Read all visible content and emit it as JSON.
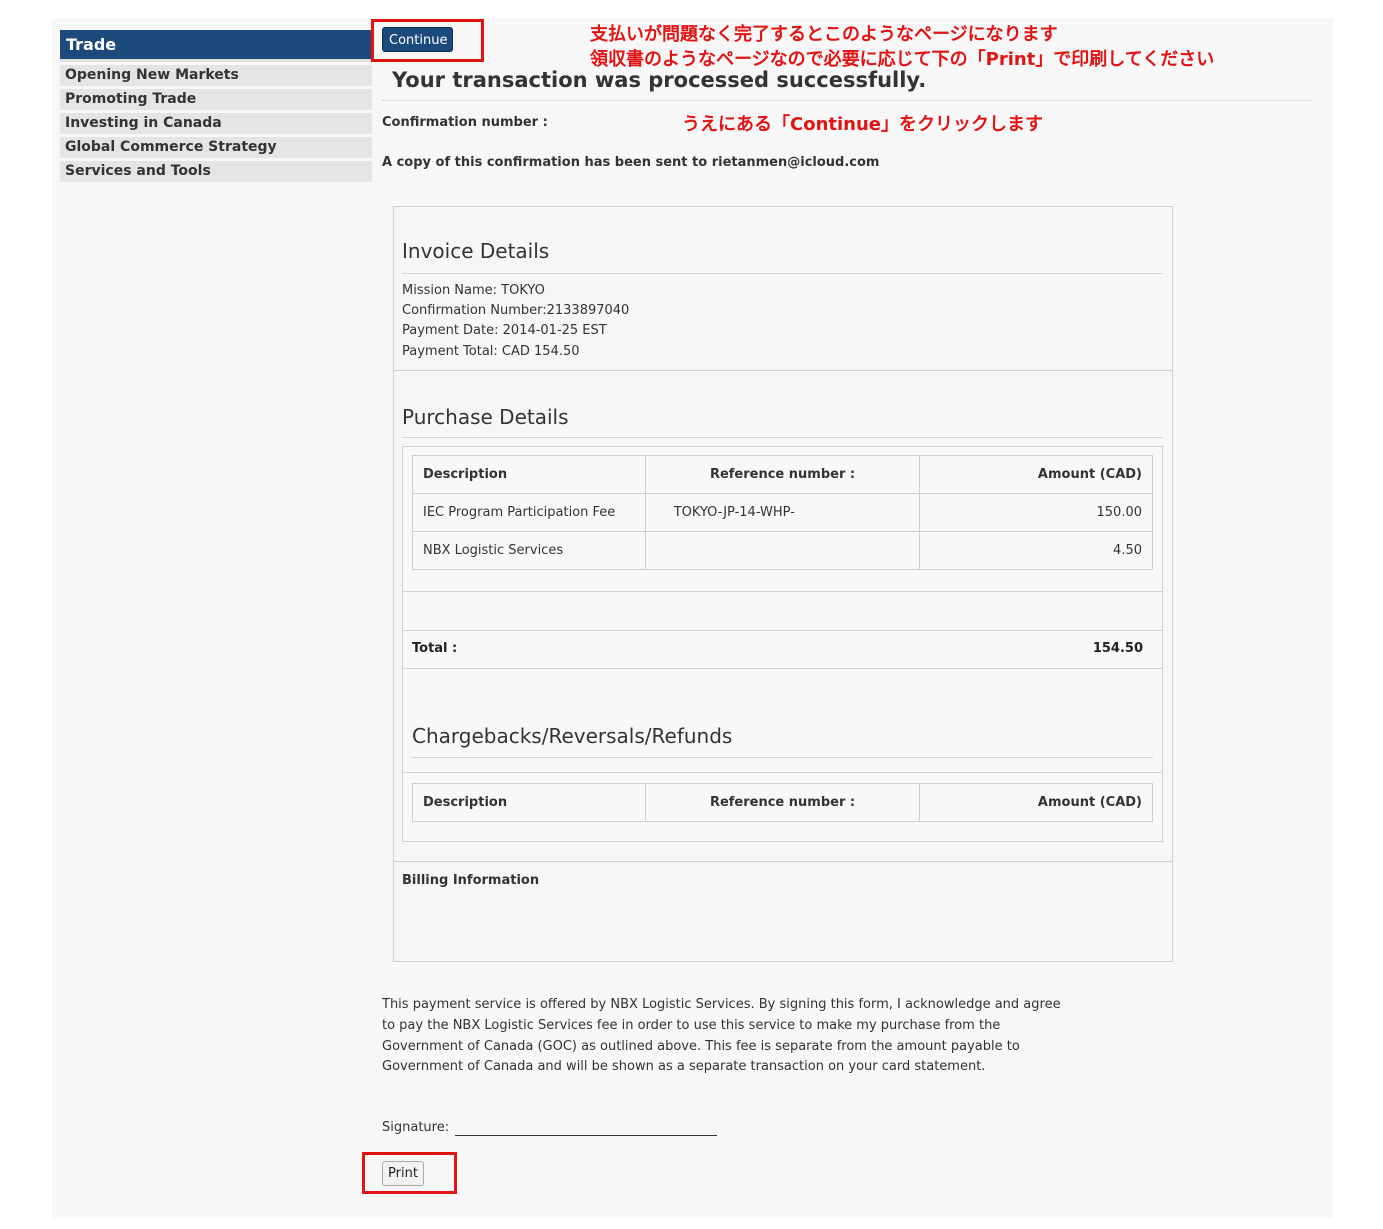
{
  "sidebar": {
    "heading": "Trade",
    "items": [
      {
        "label": "Opening New Markets"
      },
      {
        "label": "Promoting Trade"
      },
      {
        "label": "Investing in Canada"
      },
      {
        "label": "Global Commerce Strategy"
      },
      {
        "label": "Services and Tools"
      }
    ]
  },
  "toolbar": {
    "continue_label": "Continue",
    "print_label": "Print"
  },
  "annotations": {
    "line1": "支払いが問題なく完了するとこのようなページになります",
    "line2": "領収書のようなページなので必要に応じて下の「Print」で印刷してください",
    "line3": "うえにある「Continue」をクリックします",
    "color": "#e11414"
  },
  "confirmation": {
    "title": "Your transaction was processed successfully.",
    "number_label": "Confirmation number :",
    "copy_text": "A copy of this confirmation has been sent to rietanmen@icloud.com"
  },
  "invoice": {
    "title": "Invoice Details",
    "lines": [
      "Mission Name: TOKYO",
      "Confirmation Number:2133897040",
      "Payment Date: 2014-01-25 EST",
      "Payment Total: CAD 154.50"
    ]
  },
  "purchase": {
    "title": "Purchase Details",
    "headers": [
      "Description",
      "Reference number :",
      "Amount (CAD)"
    ],
    "rows": [
      {
        "description": "IEC Program Participation Fee",
        "reference": "TOKYO-JP-14-WHP-",
        "amount": "150.00"
      },
      {
        "description": "NBX Logistic Services",
        "reference": "",
        "amount": "4.50"
      }
    ],
    "total_label": "Total :",
    "total_value": "154.50"
  },
  "chargebacks": {
    "title": "Chargebacks/Reversals/Refunds",
    "headers": [
      "Description",
      "Reference number :",
      "Amount (CAD)"
    ]
  },
  "billing": {
    "title": "Billing Information"
  },
  "footer": {
    "disclaimer": "This payment service is offered by NBX Logistic Services. By signing this form, I acknowledge and agree to pay the NBX Logistic Services fee in order to use this service to make my purchase from the Government of Canada (GOC) as outlined above. This fee is separate from the amount payable to Government of Canada and will be shown as a separate transaction on your card statement.",
    "signature_label": "Signature:"
  },
  "colors": {
    "brand": "#1d4a7c",
    "highlight": "#e11414"
  }
}
